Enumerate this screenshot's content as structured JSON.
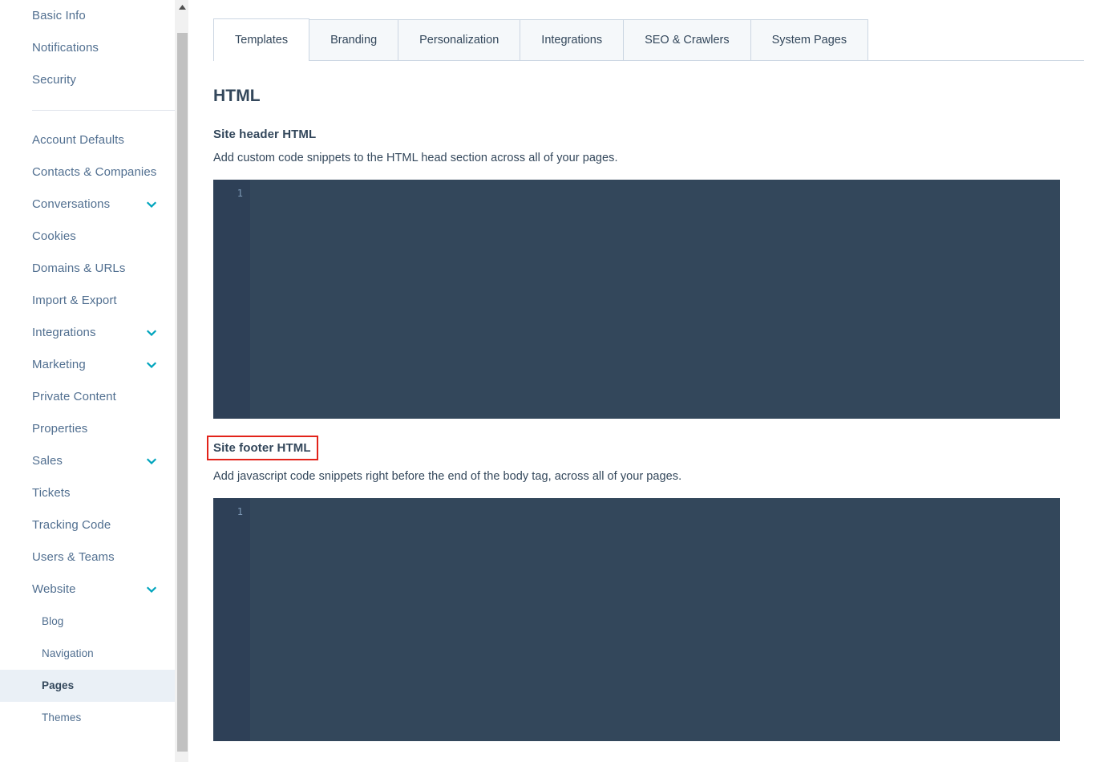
{
  "sidebar": {
    "top_items": [
      {
        "label": "Basic Info",
        "expandable": false,
        "active": false,
        "sub": false
      },
      {
        "label": "Notifications",
        "expandable": false,
        "active": false,
        "sub": false
      },
      {
        "label": "Security",
        "expandable": false,
        "active": false,
        "sub": false
      }
    ],
    "main_items": [
      {
        "label": "Account Defaults",
        "expandable": false,
        "active": false,
        "sub": false
      },
      {
        "label": "Contacts & Companies",
        "expandable": false,
        "active": false,
        "sub": false
      },
      {
        "label": "Conversations",
        "expandable": true,
        "active": false,
        "sub": false
      },
      {
        "label": "Cookies",
        "expandable": false,
        "active": false,
        "sub": false
      },
      {
        "label": "Domains & URLs",
        "expandable": false,
        "active": false,
        "sub": false
      },
      {
        "label": "Import & Export",
        "expandable": false,
        "active": false,
        "sub": false
      },
      {
        "label": "Integrations",
        "expandable": true,
        "active": false,
        "sub": false
      },
      {
        "label": "Marketing",
        "expandable": true,
        "active": false,
        "sub": false
      },
      {
        "label": "Private Content",
        "expandable": false,
        "active": false,
        "sub": false
      },
      {
        "label": "Properties",
        "expandable": false,
        "active": false,
        "sub": false
      },
      {
        "label": "Sales",
        "expandable": true,
        "active": false,
        "sub": false
      },
      {
        "label": "Tickets",
        "expandable": false,
        "active": false,
        "sub": false
      },
      {
        "label": "Tracking Code",
        "expandable": false,
        "active": false,
        "sub": false
      },
      {
        "label": "Users & Teams",
        "expandable": false,
        "active": false,
        "sub": false
      },
      {
        "label": "Website",
        "expandable": true,
        "active": false,
        "sub": false
      },
      {
        "label": "Blog",
        "expandable": false,
        "active": false,
        "sub": true
      },
      {
        "label": "Navigation",
        "expandable": false,
        "active": false,
        "sub": true
      },
      {
        "label": "Pages",
        "expandable": false,
        "active": true,
        "sub": true
      },
      {
        "label": "Themes",
        "expandable": false,
        "active": false,
        "sub": true
      }
    ],
    "chevron_color": "#00a4bd",
    "active_bg": "#eaf0f6"
  },
  "tabs": [
    {
      "label": "Templates",
      "active": true
    },
    {
      "label": "Branding",
      "active": false
    },
    {
      "label": "Personalization",
      "active": false
    },
    {
      "label": "Integrations",
      "active": false
    },
    {
      "label": "SEO & Crawlers",
      "active": false
    },
    {
      "label": "System Pages",
      "active": false
    }
  ],
  "main": {
    "page_title": "HTML",
    "sections": [
      {
        "title": "Site header HTML",
        "description": "Add custom code snippets to the HTML head section across all of your pages.",
        "highlighted": false,
        "editor": {
          "line_numbers": [
            "1"
          ],
          "value": ""
        }
      },
      {
        "title": "Site footer HTML",
        "description": "Add javascript code snippets right before the end of the body tag, across all of your pages.",
        "highlighted": true,
        "editor": {
          "line_numbers": [
            "1"
          ],
          "value": ""
        }
      }
    ],
    "highlight_color": "#e2231a",
    "editor_bg": "#33475b",
    "editor_gutter_bg": "#2e4057"
  }
}
